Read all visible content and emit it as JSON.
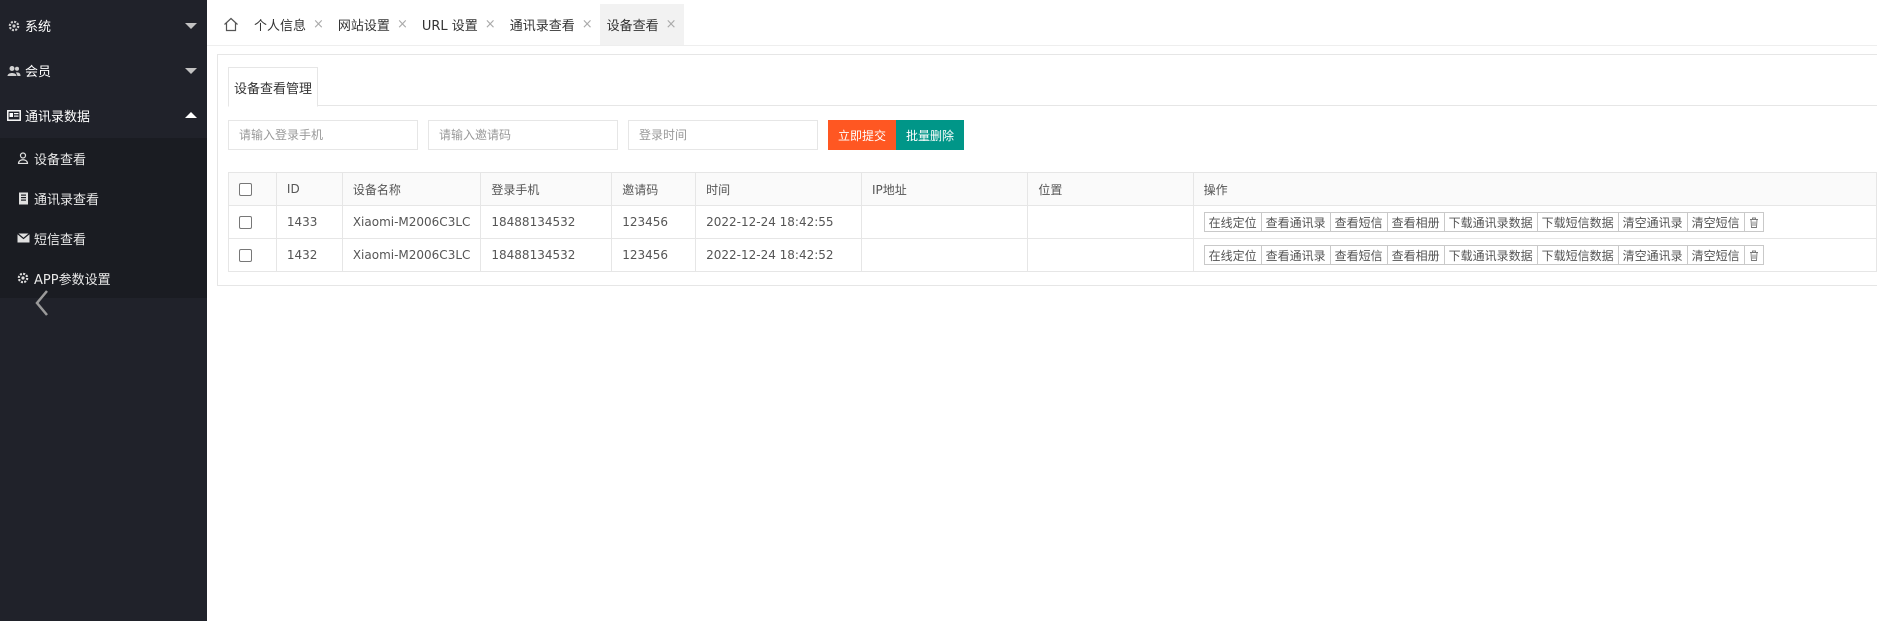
{
  "sidebar": {
    "groups": [
      {
        "label": "系统",
        "icon": "gear-icon",
        "expanded": false
      },
      {
        "label": "会员",
        "icon": "users-icon",
        "expanded": false
      },
      {
        "label": "通讯录数据",
        "icon": "id-card-icon",
        "expanded": true
      }
    ],
    "items": [
      {
        "label": "设备查看",
        "icon": "user-outline-icon"
      },
      {
        "label": "通讯录查看",
        "icon": "book-icon"
      },
      {
        "label": "短信查看",
        "icon": "envelope-icon"
      },
      {
        "label": "APP参数设置",
        "icon": "gear-icon"
      }
    ],
    "colors": {
      "bg": "#20222a",
      "sub_bg": "#1a1c22"
    }
  },
  "tabs": {
    "home_icon": "home-icon",
    "items": [
      {
        "label": "个人信息",
        "active": false
      },
      {
        "label": "网站设置",
        "active": false
      },
      {
        "label": "URL 设置",
        "active": false
      },
      {
        "label": "通讯录查看",
        "active": false
      },
      {
        "label": "设备查看",
        "active": true
      }
    ],
    "close_glyph": "×"
  },
  "panel": {
    "tab_label": "设备查看管理"
  },
  "search": {
    "phone_placeholder": "请输入登录手机",
    "invite_placeholder": "请输入邀请码",
    "time_placeholder": "登录时间",
    "submit_label": "立即提交",
    "batch_delete_label": "批量删除"
  },
  "colors": {
    "danger": "#ff5722",
    "primary": "#009688"
  },
  "table": {
    "headers": [
      "ID",
      "设备名称",
      "登录手机",
      "邀请码",
      "时间",
      "IP地址",
      "位置",
      "操作"
    ],
    "rows": [
      {
        "id": "1433",
        "device": "Xiaomi-M2006C3LC",
        "phone": "18488134532",
        "invite": "123456",
        "time": "2022-12-24 18:42:55",
        "ip": "",
        "location": ""
      },
      {
        "id": "1432",
        "device": "Xiaomi-M2006C3LC",
        "phone": "18488134532",
        "invite": "123456",
        "time": "2022-12-24 18:42:52",
        "ip": "",
        "location": ""
      }
    ],
    "actions": [
      "在线定位",
      "查看通讯录",
      "查看短信",
      "查看相册",
      "下载通讯录数据",
      "下载短信数据",
      "清空通讯录",
      "清空短信"
    ],
    "delete_icon": "trash-icon"
  }
}
